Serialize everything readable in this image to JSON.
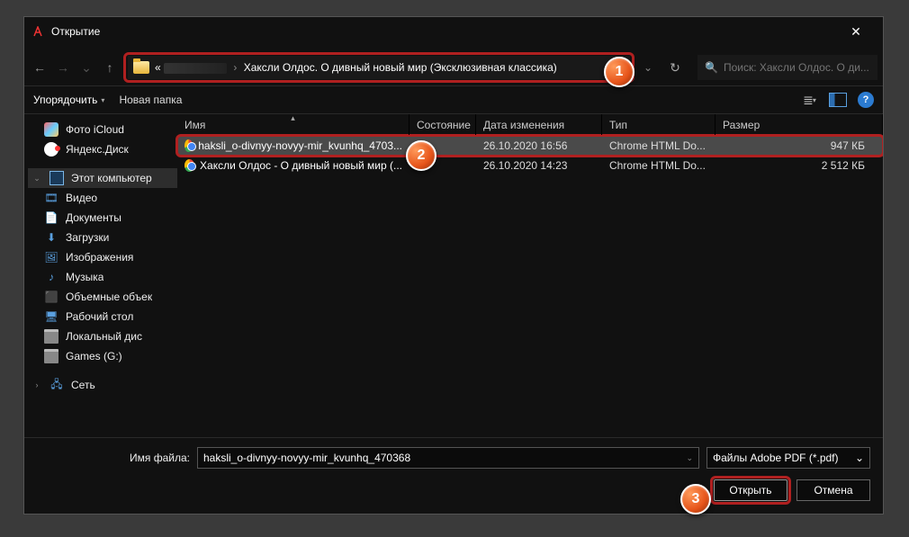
{
  "window": {
    "title": "Открытие",
    "close_glyph": "✕"
  },
  "nav": {
    "back_glyph": "←",
    "fwd_glyph": "→",
    "up_glyph": "↑",
    "refresh_glyph": "↻",
    "down_glyph": "⌄",
    "chevron": "›",
    "prefix": "«",
    "crumb_last": "Хаксли Олдос. О дивный новый мир (Эксклюзивная классика)"
  },
  "search": {
    "placeholder": "Поиск: Хаксли Олдос. О ди...",
    "icon": "🔍"
  },
  "toolbar": {
    "organize": "Упорядочить",
    "newfolder": "Новая папка",
    "help_glyph": "?",
    "dd": "▾"
  },
  "sidebar": {
    "items": [
      {
        "label": "Фото iCloud",
        "iconClass": "ic-photos",
        "exp": "",
        "lvl": 1
      },
      {
        "label": "Яндекс.Диск",
        "iconClass": "ic-ydisk",
        "exp": "",
        "lvl": 1
      },
      {
        "label": "",
        "spacer": true
      },
      {
        "label": "Этот компьютер",
        "iconClass": "ic-pc",
        "exp": "⌄",
        "lvl": 0,
        "selected": true
      },
      {
        "label": "Видео",
        "iconClass": "ic-video",
        "glyph": "🎞",
        "lvl": 1
      },
      {
        "label": "Документы",
        "iconClass": "ic-docs",
        "glyph": "📄",
        "lvl": 1
      },
      {
        "label": "Загрузки",
        "iconClass": "ic-dl",
        "glyph": "⬇",
        "lvl": 1
      },
      {
        "label": "Изображения",
        "iconClass": "ic-img",
        "glyph": "🖼",
        "lvl": 1
      },
      {
        "label": "Музыка",
        "iconClass": "ic-music",
        "glyph": "♪",
        "lvl": 1
      },
      {
        "label": "Объемные объек",
        "iconClass": "ic-3d",
        "glyph": "⬛",
        "lvl": 1
      },
      {
        "label": "Рабочий стол",
        "iconClass": "ic-desk",
        "glyph": "🖥",
        "lvl": 1
      },
      {
        "label": "Локальный дис",
        "iconClass": "ic-drive",
        "lvl": 1
      },
      {
        "label": "Games (G:)",
        "iconClass": "ic-drive",
        "lvl": 1
      },
      {
        "label": "",
        "spacer": true
      },
      {
        "label": "Сеть",
        "iconClass": "ic-net",
        "glyph": "🖧",
        "exp": "›",
        "lvl": 0
      }
    ]
  },
  "columns": {
    "name": "Имя",
    "state": "Состояние",
    "date": "Дата изменения",
    "type": "Тип",
    "size": "Размер"
  },
  "files": [
    {
      "name": "haksli_o-divnyy-novyy-mir_kvunhq_4703...",
      "date": "26.10.2020 16:56",
      "type": "Chrome HTML Do...",
      "size": "947 КБ",
      "selected": true,
      "highlight": true
    },
    {
      "name": "Хаксли Олдос - О дивный новый мир (...",
      "date": "26.10.2020 14:23",
      "type": "Chrome HTML Do...",
      "size": "2 512 КБ"
    }
  ],
  "bottom": {
    "fn_label": "Имя файла:",
    "fn_value": "haksli_o-divnyy-novyy-mir_kvunhq_470368",
    "filter": "Файлы Adobe PDF (*.pdf)",
    "open": "Открыть",
    "cancel": "Отмена",
    "dd": "⌄"
  },
  "markers": {
    "m1": "1",
    "m2": "2",
    "m3": "3"
  }
}
